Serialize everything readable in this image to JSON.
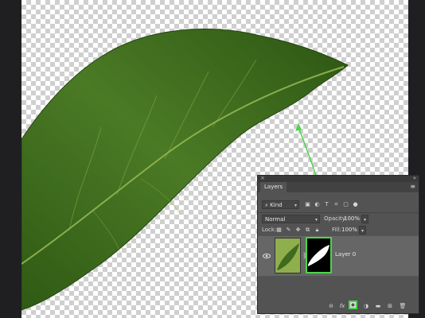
{
  "panel": {
    "close_glyph": "×",
    "collapse_glyph": "»",
    "tab_label": "Layers",
    "menu_glyph": "≡",
    "filter": {
      "kind_label": "Kind",
      "icons": [
        "image-filter-icon",
        "adjustment-filter-icon",
        "type-filter-icon",
        "shape-filter-icon",
        "smart-object-filter-icon",
        "filter-toggle-icon"
      ]
    },
    "blend_mode": "Normal",
    "opacity_label": "Opacity:",
    "opacity_value": "100%",
    "lock_label": "Lock:",
    "fill_label": "Fill:",
    "fill_value": "100%",
    "layer": {
      "name": "Layer 0",
      "visible": true
    },
    "bottom_icons": [
      "link-layers-icon",
      "fx-icon",
      "add-mask-icon",
      "adjustment-layer-icon",
      "group-icon",
      "new-layer-icon",
      "delete-icon"
    ],
    "fx_label": "fx"
  },
  "colors": {
    "highlight": "#4ad64a",
    "leaf": "#3f6b1f",
    "panel_bg": "#535353"
  }
}
